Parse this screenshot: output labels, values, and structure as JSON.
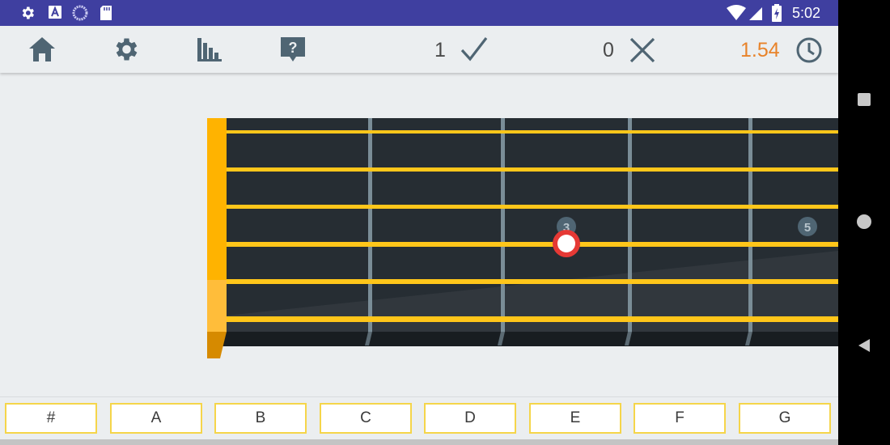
{
  "status_bar": {
    "time": "5:02",
    "left_icons": [
      "gear-icon",
      "text-a-icon",
      "sync-circle-icon",
      "sd-card-icon"
    ],
    "right_icons": [
      "wifi-icon",
      "signal-icon",
      "battery-charging-icon"
    ],
    "background": "#3f3fa0"
  },
  "toolbar": {
    "buttons": [
      "home-icon",
      "settings-icon",
      "statistics-icon",
      "help-icon"
    ],
    "correct_count": "1",
    "wrong_count": "0",
    "timer": "1.54",
    "timer_color": "#e8832a",
    "icon_color": "#4f6573"
  },
  "fretboard": {
    "strings": 6,
    "frets_visible": 5,
    "fret_markers": [
      "3",
      "5"
    ],
    "target_note": {
      "string": 4,
      "fret": 3
    },
    "colors": {
      "board": "#262d33",
      "string": "#ffc61a",
      "fret": "#7a8d97",
      "nut": "#ffb300",
      "target_ring": "#e53935"
    }
  },
  "answer_buttons": [
    "#",
    "A",
    "B",
    "C",
    "D",
    "E",
    "F",
    "G"
  ],
  "nav_bar": {
    "buttons": [
      "recents-square-icon",
      "home-circle-icon",
      "back-triangle-icon"
    ]
  }
}
